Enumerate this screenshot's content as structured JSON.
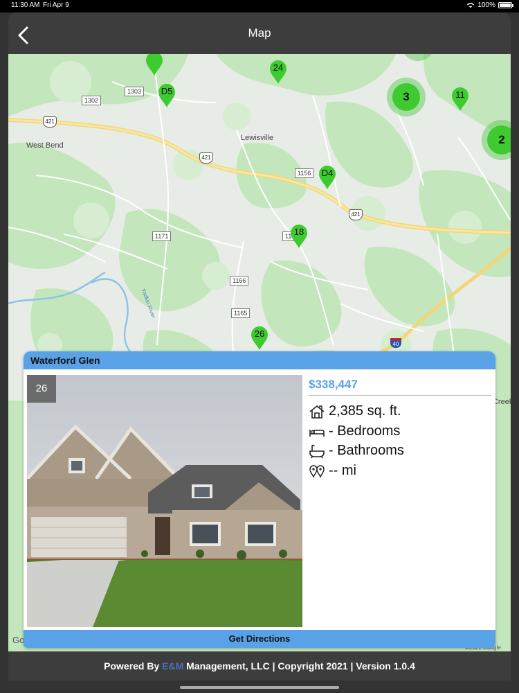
{
  "status_bar": {
    "time": "11:30 AM",
    "date": "Fri Apr 9",
    "battery": "100%"
  },
  "nav": {
    "title": "Map"
  },
  "map": {
    "place_labels": [
      "West Bend",
      "Lewisville",
      "Yadkin River",
      "Creek"
    ],
    "road_labels": [
      "1303",
      "1302",
      "1156",
      "1171",
      "1166",
      "1165",
      "11"
    ],
    "us_routes": [
      "421",
      "421",
      "421"
    ],
    "interstate": "40",
    "markers": [
      "24",
      "D5",
      "11",
      "D4",
      "18",
      "26"
    ],
    "clusters": [
      "3",
      "2"
    ],
    "attribution_left": "Go",
    "attribution_right": "©2021 Google"
  },
  "card": {
    "community": "Waterford Glen",
    "lot_number": "26",
    "price": "$338,447",
    "sqft": "2,385 sq. ft.",
    "bedrooms": "- Bedrooms",
    "bathrooms": "- Bathrooms",
    "distance": "-- mi",
    "directions_label": "Get Directions"
  },
  "footer": {
    "prefix": "Powered By ",
    "brand": "E&M",
    "suffix": " Management, LLC | Copyright 2021 | Version 1.0.4"
  },
  "colors": {
    "accent": "#5aa2e8",
    "marker": "#3ecb2f",
    "bar": "#3d3d3d"
  }
}
